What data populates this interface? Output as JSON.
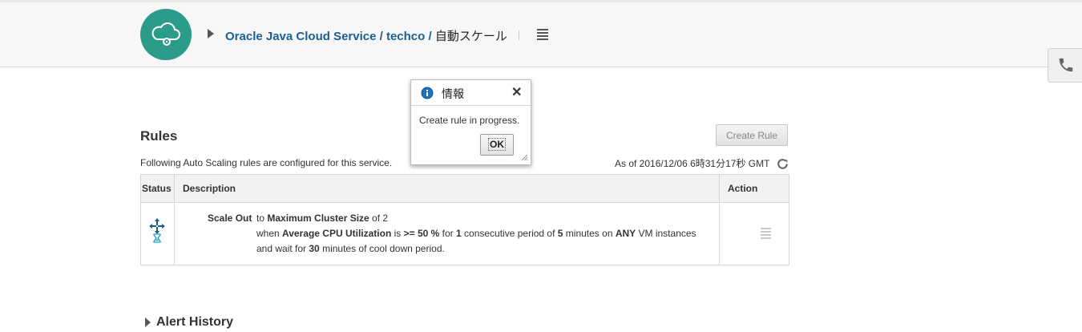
{
  "header": {
    "breadcrumb": {
      "service_link": "Oracle Java Cloud Service",
      "separator": " / ",
      "instance_link": "techco",
      "current": "自動スケール"
    },
    "icons": {
      "logo": "cloud-gear-icon",
      "menu": "hamburger-menu-icon",
      "phone": "phone-icon"
    },
    "logo_color": "#2c9c8a"
  },
  "rules": {
    "title": "Rules",
    "create_button": "Create Rule",
    "description": "Following Auto Scaling rules are configured for this service.",
    "as_of": "As of 2016/12/06 6時31分17秒 GMT",
    "table": {
      "columns": [
        "Status",
        "Description",
        "Action"
      ],
      "rows": [
        {
          "status_icon": "scale-out-pending-icon",
          "type": "Scale Out",
          "line1": {
            "pre": "to ",
            "b1": "Maximum Cluster Size",
            "post": " of 2"
          },
          "line2": {
            "t1": "when ",
            "b1": "Average CPU Utilization",
            "t2": " is ",
            "b2": ">= 50 %",
            "t3": " for ",
            "b3": "1",
            "t4": " consecutive period of ",
            "b4": "5",
            "t5": " minutes on ",
            "b5": "ANY",
            "t6": " VM instances"
          },
          "line3": {
            "t1": "and wait for ",
            "b1": "30",
            "t2": " minutes of cool down period."
          }
        }
      ]
    }
  },
  "alert_history": {
    "title": "Alert History"
  },
  "dialog": {
    "title": "情報",
    "message": "Create rule in progress.",
    "ok_button": "OK",
    "close_symbol": "✕"
  },
  "colors": {
    "link": "#1a5f94",
    "accent": "#2c9c8a",
    "info_blue": "#1e73be"
  }
}
